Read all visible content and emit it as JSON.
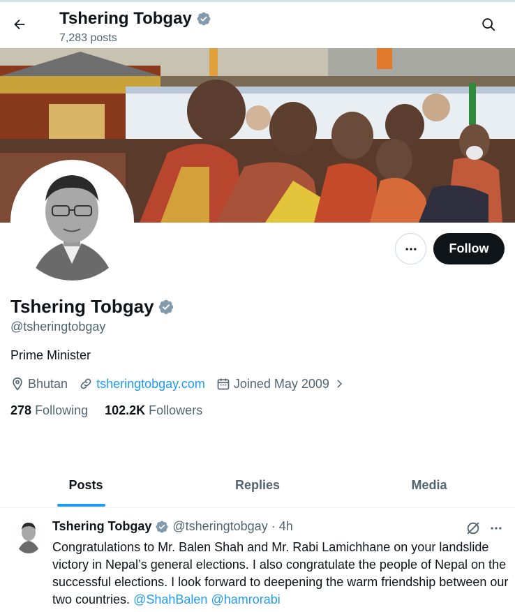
{
  "header": {
    "name": "Tshering Tobgay",
    "posts_count": "7,283 posts"
  },
  "profile": {
    "display_name": "Tshering Tobgay",
    "handle": "@tsheringtobgay",
    "bio": "Prime Minister",
    "location": "Bhutan",
    "website": "tsheringtobgay.com",
    "joined": "Joined May 2009",
    "following_count": "278",
    "following_label": "Following",
    "followers_count": "102.2K",
    "followers_label": "Followers",
    "follow_label": "Follow",
    "verified": true
  },
  "tabs": [
    {
      "label": "Posts",
      "active": true
    },
    {
      "label": "Replies",
      "active": false
    },
    {
      "label": "Media",
      "active": false
    }
  ],
  "post": {
    "author_name": "Tshering Tobgay",
    "author_handle": "@tsheringtobgay",
    "separator": "·",
    "time": "4h",
    "text": "Congratulations to Mr. Balen Shah and Mr. Rabi Lamichhane on your landslide victory in Nepal’s general elections. I also congratulate the people of Nepal on the successful elections. I look forward to deepening the warm friendship between our two countries.",
    "mention_1": "@ShahBalen",
    "mention_2": "@hamrorabi"
  },
  "icons": {
    "back": "arrow-left-icon",
    "search": "search-icon",
    "verified": "verified-badge-icon",
    "more": "more-horizontal-icon",
    "location": "location-pin-icon",
    "link": "link-icon",
    "calendar": "calendar-icon",
    "chevron": "chevron-right-icon",
    "grok": "grok-icon"
  },
  "colors": {
    "accent": "#1d9bf0",
    "text": "#0f1419",
    "secondary": "#536471",
    "verified": "#829aab",
    "follow_bg": "#0f1419"
  }
}
